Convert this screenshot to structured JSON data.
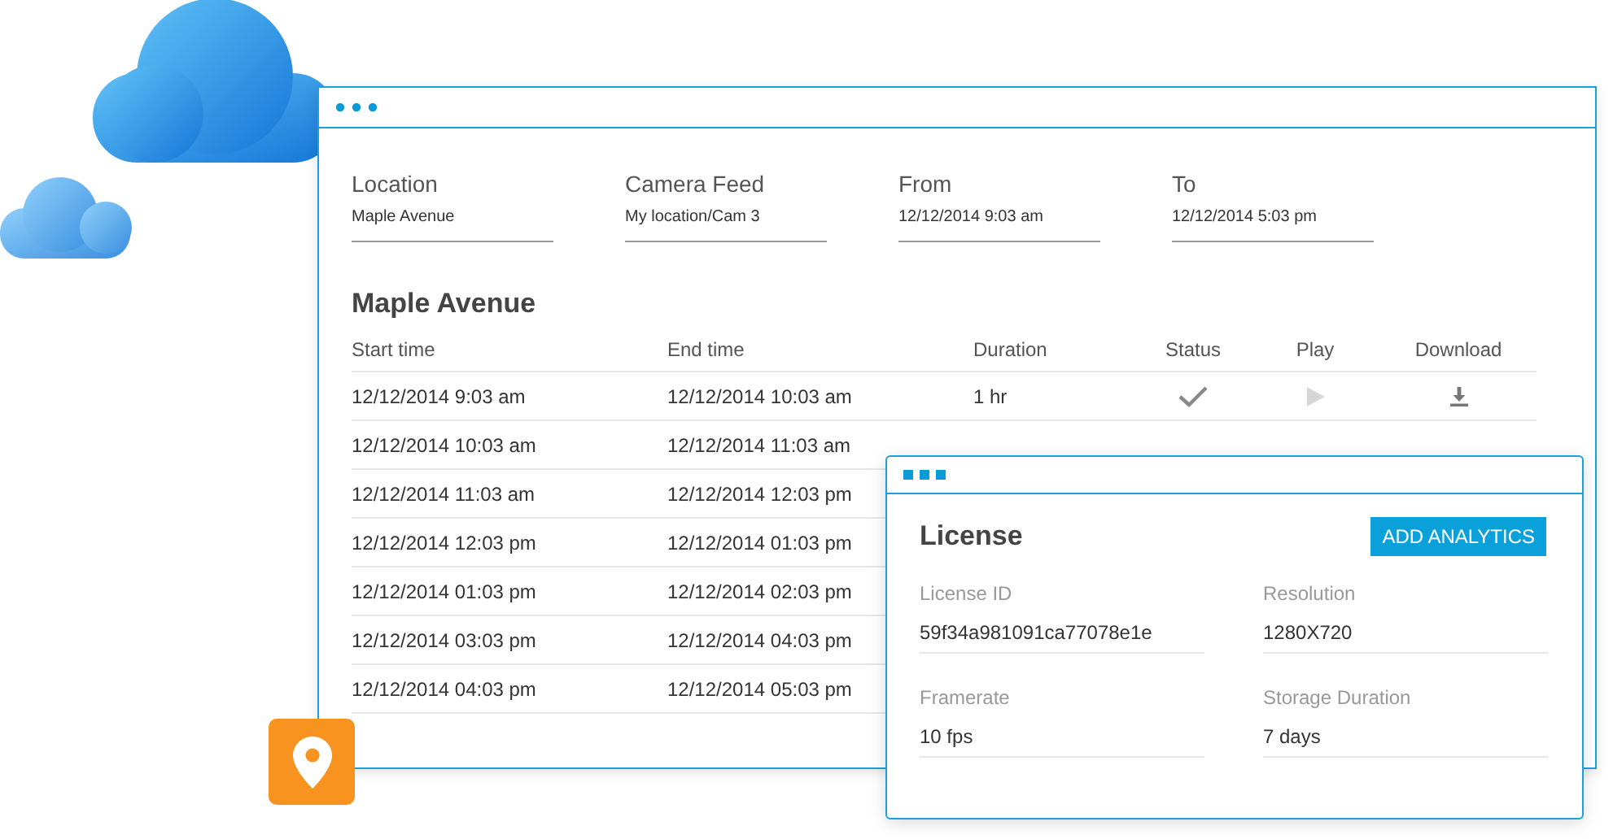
{
  "filters": [
    {
      "label": "Location",
      "value": "Maple Avenue"
    },
    {
      "label": "Camera Feed",
      "value": "My location/Cam 3"
    },
    {
      "label": "From",
      "value": "12/12/2014 9:03 am"
    },
    {
      "label": "To",
      "value": "12/12/2014 5:03 pm"
    }
  ],
  "table": {
    "title": "Maple Avenue",
    "columns": [
      "Start time",
      "End time",
      "Duration",
      "Status",
      "Play",
      "Download"
    ],
    "rows": [
      {
        "start": "12/12/2014 9:03 am",
        "end": "12/12/2014 10:03 am",
        "duration": "1 hr",
        "done": true
      },
      {
        "start": "12/12/2014 10:03 am",
        "end": "12/12/2014 11:03 am"
      },
      {
        "start": "12/12/2014 11:03 am",
        "end": "12/12/2014 12:03 pm"
      },
      {
        "start": "12/12/2014 12:03 pm",
        "end": "12/12/2014 01:03 pm"
      },
      {
        "start": "12/12/2014 01:03 pm",
        "end": "12/12/2014 02:03 pm"
      },
      {
        "start": "12/12/2014 03:03 pm",
        "end": "12/12/2014 04:03 pm"
      },
      {
        "start": "12/12/2014 04:03 pm",
        "end": "12/12/2014 05:03 pm"
      }
    ]
  },
  "license": {
    "title": "License",
    "button": "ADD ANALYTICS",
    "fields": [
      {
        "label": "License ID",
        "value": "59f34a981091ca77078e1e"
      },
      {
        "label": "Resolution",
        "value": "1280X720"
      },
      {
        "label": "Framerate",
        "value": "10 fps"
      },
      {
        "label": "Storage Duration",
        "value": "7 days"
      }
    ]
  }
}
